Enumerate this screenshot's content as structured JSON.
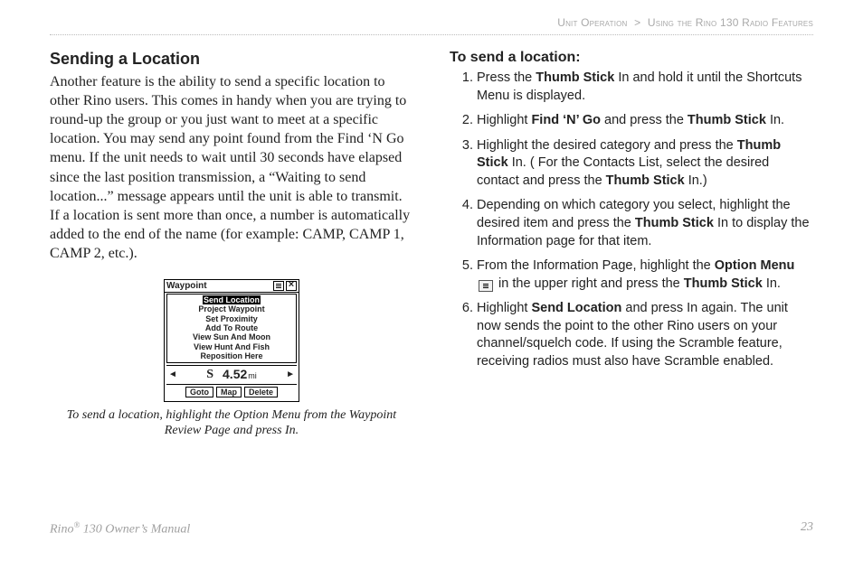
{
  "header": {
    "crumb_left": "Unit Operation",
    "crumb_sep": ">",
    "crumb_right": "Using the Rino 130 Radio Features"
  },
  "left": {
    "heading": "Sending a Location",
    "paragraph": "Another feature is the ability to send a specific location to other Rino users. This comes in handy when you are trying to round-up the group or you just want to meet at a specific location. You may send any point found from the Find ‘N Go menu. If the unit needs to wait until 30 seconds have elapsed since the last position transmission, a “Waiting to send location...” message appears until the unit is able to transmit. If a location is sent more than once, a number is automatically added to the end of the name (for example: CAMP, CAMP 1, CAMP 2, etc.).",
    "device": {
      "title": "Waypoint",
      "menu": [
        "Send Location",
        "Project Waypoint",
        "Set Proximity",
        "Add To Route",
        "View Sun And Moon",
        "View Hunt And Fish",
        "Reposition Here"
      ],
      "direction": "S",
      "distance_value": "4.52",
      "distance_unit": "mi",
      "buttons": [
        "Goto",
        "Map",
        "Delete"
      ]
    },
    "caption": "To send a location, highlight the Option Menu from the Waypoint Review Page and press In."
  },
  "right": {
    "heading": "To send a location:",
    "step1_a": "Press the ",
    "step1_b": "Thumb Stick",
    "step1_c": " In and hold it until the Shortcuts Menu is displayed.",
    "step2_a": "Highlight ",
    "step2_b": "Find ‘N’ Go",
    "step2_c": " and press the ",
    "step2_d": "Thumb Stick",
    "step2_e": " In.",
    "step3_a": "Highlight the desired category and press the ",
    "step3_b": "Thumb Stick",
    "step3_c": " In. ( For the Contacts List, select the desired contact and press the ",
    "step3_d": "Thumb Stick",
    "step3_e": " In.)",
    "step4_a": "Depending on which category you select, highlight the desired item and press the ",
    "step4_b": "Thumb Stick",
    "step4_c": " In to display the Information page for that item.",
    "step5_a": "From the Information Page, highlight the ",
    "step5_b": "Option Menu",
    "step5_c": " in the upper right and press the ",
    "step5_d": "Thumb Stick",
    "step5_e": " In.",
    "step6_a": "Highlight ",
    "step6_b": "Send Location",
    "step6_c": " and press In again. The unit now sends the point to the other Rino users on your channel/squelch code. If using the Scramble feature, receiving radios must also have Scramble enabled."
  },
  "footer": {
    "left_a": "Rino",
    "left_b": " 130 Owner’s Manual",
    "page": "23"
  }
}
